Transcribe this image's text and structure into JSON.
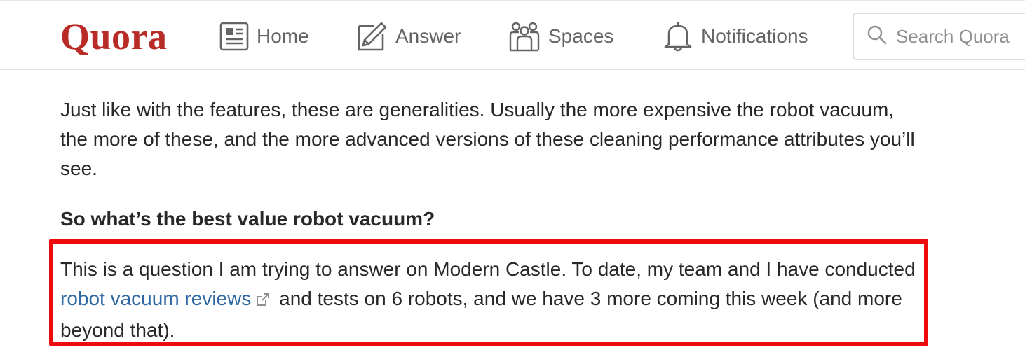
{
  "header": {
    "logo": "Quora",
    "nav": {
      "home": "Home",
      "answer": "Answer",
      "spaces": "Spaces",
      "notifications": "Notifications"
    },
    "search": {
      "placeholder": "Search Quora"
    }
  },
  "article": {
    "paragraph1": "Just like with the features, these are generalities. Usually the more expensive the robot vacuum, the more of these, and the more advanced versions of these cleaning performance attributes you’ll see.",
    "heading": "So what’s the best value robot vacuum?",
    "paragraph2_before": "This is a question I am trying to answer on Modern Castle. To date, my team and I have conducted ",
    "link_text": "robot vacuum reviews",
    "paragraph2_after": " and tests on 6 robots, and we have 3 more coming this week (and more beyond that)."
  },
  "colors": {
    "brand": "#b92b27",
    "link": "#2e69a3",
    "highlight_border": "#ee0b0b",
    "icon": "#636466"
  },
  "icons": [
    "home-icon",
    "answer-icon",
    "spaces-icon",
    "bell-icon",
    "search-icon",
    "external-link-icon"
  ]
}
